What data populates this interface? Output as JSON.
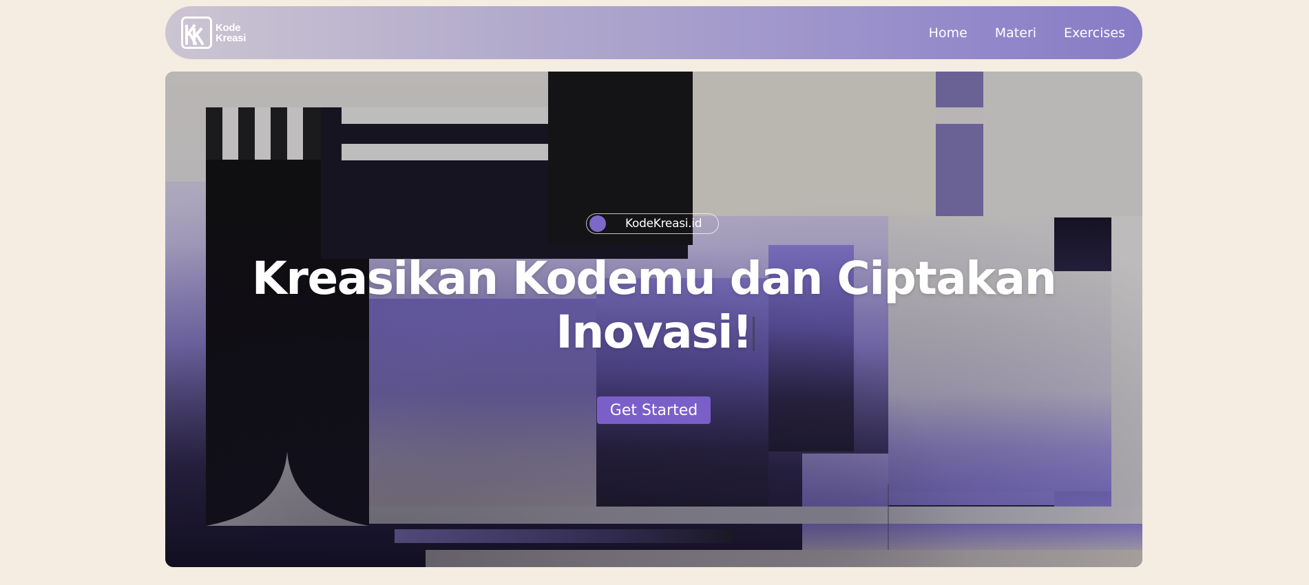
{
  "logo": {
    "line1": "Kode",
    "line2": "Kreasi"
  },
  "nav": {
    "items": [
      {
        "label": "Home"
      },
      {
        "label": "Materi"
      },
      {
        "label": "Exercises"
      }
    ]
  },
  "hero": {
    "badge_text": "KodeKreasi.id",
    "headline_line1": "Kreasikan Kodemu dan Ciptakan",
    "headline_line2": "Inovasi!",
    "cta_label": "Get Started"
  },
  "colors": {
    "page_background": "#f5ece2",
    "accent": "#7b5fc9",
    "navbar_gradient_start": "#cbc5d2",
    "navbar_gradient_end": "#877cc6",
    "text_on_accent": "#ffffff"
  },
  "icons": {
    "logo": "kk-monogram-icon",
    "badge_dot": "circle-dot-icon"
  }
}
